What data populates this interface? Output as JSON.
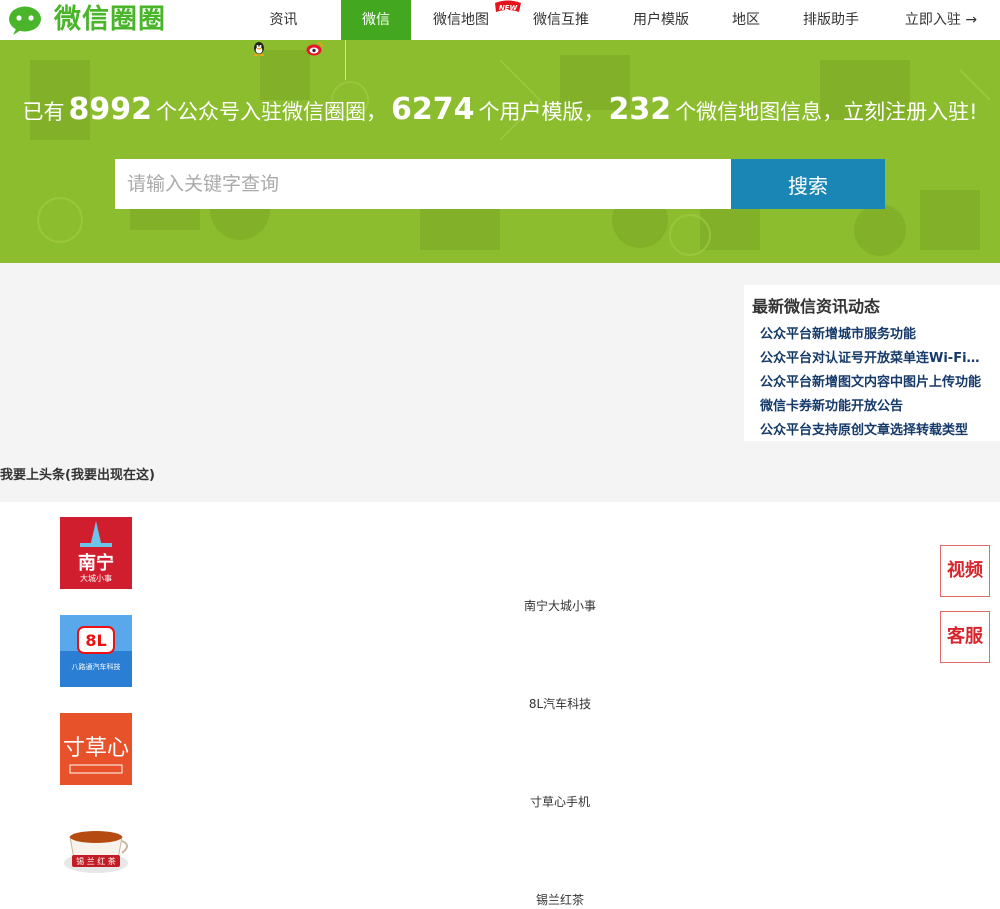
{
  "brand": {
    "name": "微信圈圈",
    "color": "#4ab52a"
  },
  "nav": {
    "items": [
      {
        "label": "资讯",
        "width": 115
      },
      {
        "label": "微信",
        "width": 70,
        "active": true
      },
      {
        "label": "微信地图",
        "width": 100,
        "badge": "NEW"
      },
      {
        "label": "微信互推",
        "width": 100
      },
      {
        "label": "用户模版",
        "width": 100
      },
      {
        "label": "地区",
        "width": 70
      },
      {
        "label": "排版助手",
        "width": 100
      },
      {
        "label": "立即入驻 →",
        "width": 120
      }
    ]
  },
  "social": {
    "qq_icon": "qq-penguin-icon",
    "weibo_icon": "weibo-icon"
  },
  "hero": {
    "prefix": "已有",
    "accounts_count": "8992",
    "accounts_text": "个公众号入驻微信圈圈，",
    "templates_count": "6274",
    "templates_text": "个用户模版，",
    "map_count": "232",
    "map_text": "个微信地图信息，立刻注册入驻!",
    "bg_color": "#8cbd2e"
  },
  "search": {
    "placeholder": "请输入关键字查询",
    "button_label": "搜索",
    "button_color": "#1a86b5"
  },
  "news": {
    "title": "最新微信资讯动态",
    "items": [
      "公众平台新增城市服务功能",
      "公众平台对认证号开放菜单连Wi-Fi功能",
      "公众平台新增图文内容中图片上传功能",
      "微信卡券新功能开放公告",
      "公众平台支持原创文章选择转载类型"
    ]
  },
  "headline_label": "我要上头条(我要出现在这)",
  "accounts": [
    {
      "name": "南宁大城小事",
      "thumb": "nanning-logo-icon"
    },
    {
      "name": "8L汽车科技",
      "thumb": "8l-logo-icon"
    },
    {
      "name": "寸草心手机",
      "thumb": "cuncaoxin-logo-icon"
    },
    {
      "name": "锡兰红茶",
      "thumb": "tea-cup-logo-icon"
    }
  ],
  "side_buttons": {
    "video": "视频",
    "service": "客服"
  }
}
